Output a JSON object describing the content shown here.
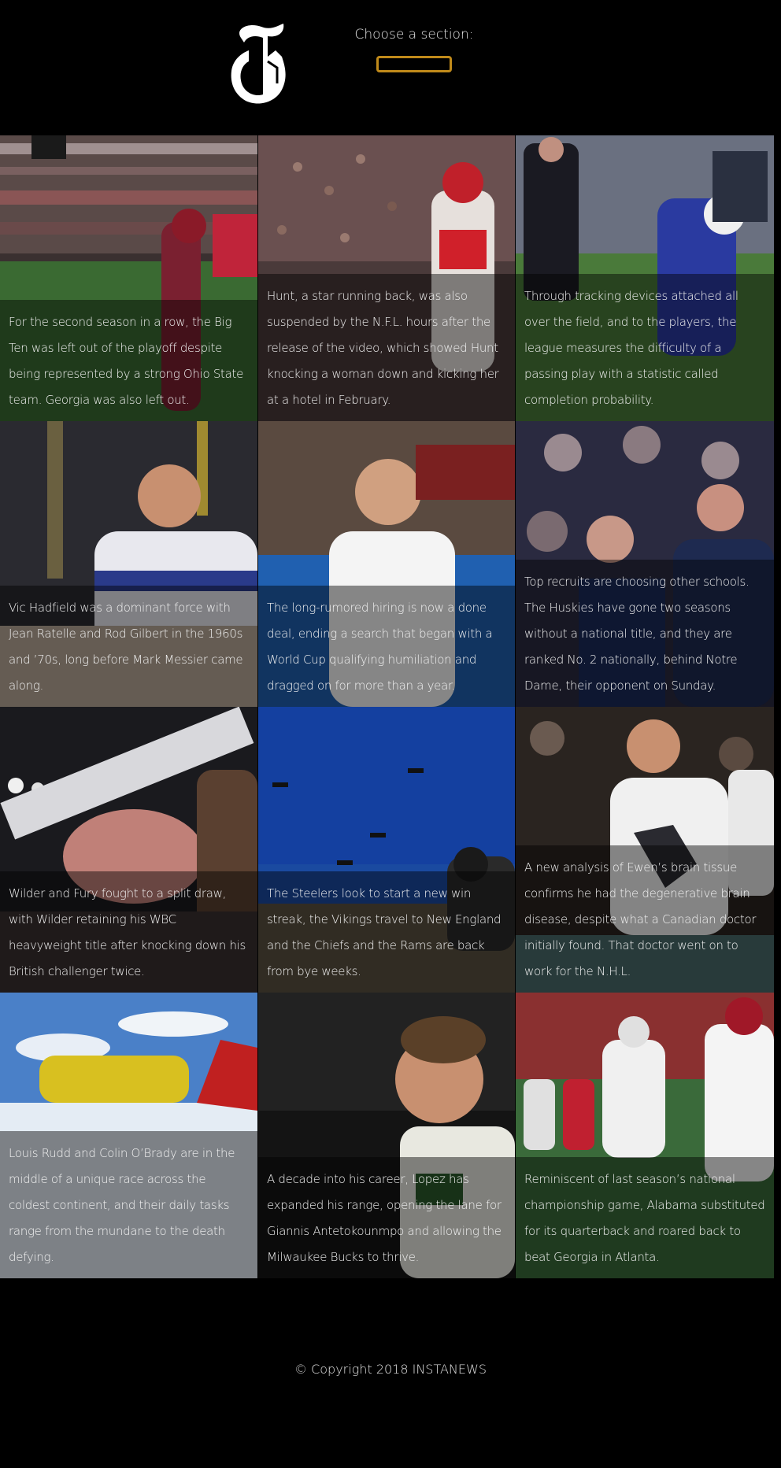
{
  "header": {
    "logo_alt": "T",
    "section_label": "Choose a section:",
    "section_selected": ""
  },
  "articles": [
    {
      "caption": "For the second season in a row, the Big Ten was left out of the playoff despite being represented by a strong Ohio State team. Georgia was also left out."
    },
    {
      "caption": "Hunt, a star running back, was also suspended by the N.F.L. hours after the release of the video, which showed Hunt knocking a woman down and kicking her at a hotel in February."
    },
    {
      "caption": "Through tracking devices attached all over the field, and to the players, the league measures the difficulty of a passing play with a statistic called completion probability."
    },
    {
      "caption": "Vic Hadfield was a dominant force with Jean Ratelle and Rod Gilbert in the 1960s and ’70s, long before Mark Messier came along."
    },
    {
      "caption": "The long-rumored hiring is now a done deal, ending a search that began with a World Cup qualifying humiliation and dragged on for more than a year."
    },
    {
      "caption": "Top recruits are choosing other schools. The Huskies have gone two seasons without a national title, and they are ranked No. 2 nationally, behind Notre Dame, their opponent on Sunday."
    },
    {
      "caption": "Wilder and Fury fought to a split draw, with Wilder retaining his WBC heavyweight title after knocking down his British challenger twice."
    },
    {
      "caption": "The Steelers look to start a new win streak, the Vikings travel to New England and the Chiefs and the Rams are back from bye weeks."
    },
    {
      "caption": "A new analysis of Ewen’s brain tissue confirms he had the degenerative brain disease, despite what a Canadian doctor initially found. That doctor went on to work for the N.H.L."
    },
    {
      "caption": "Louis Rudd and Colin O’Brady are in the middle of a unique race across the coldest continent, and their daily tasks range from the mundane to the death defying."
    },
    {
      "caption": "A decade into his career, Lopez has expanded his range, opening the lane for Giannis Antetokounmpo and allowing the Milwaukee Bucks to thrive."
    },
    {
      "caption": "Reminiscent of last season’s national championship game, Alabama substituted for its quarterback and roared back to beat Georgia in Atlanta."
    }
  ],
  "footer": {
    "copyright": "© Copyright 2018 INSTANEWS"
  },
  "colors": {
    "background": "#000000",
    "select_border": "#c08a1a"
  }
}
